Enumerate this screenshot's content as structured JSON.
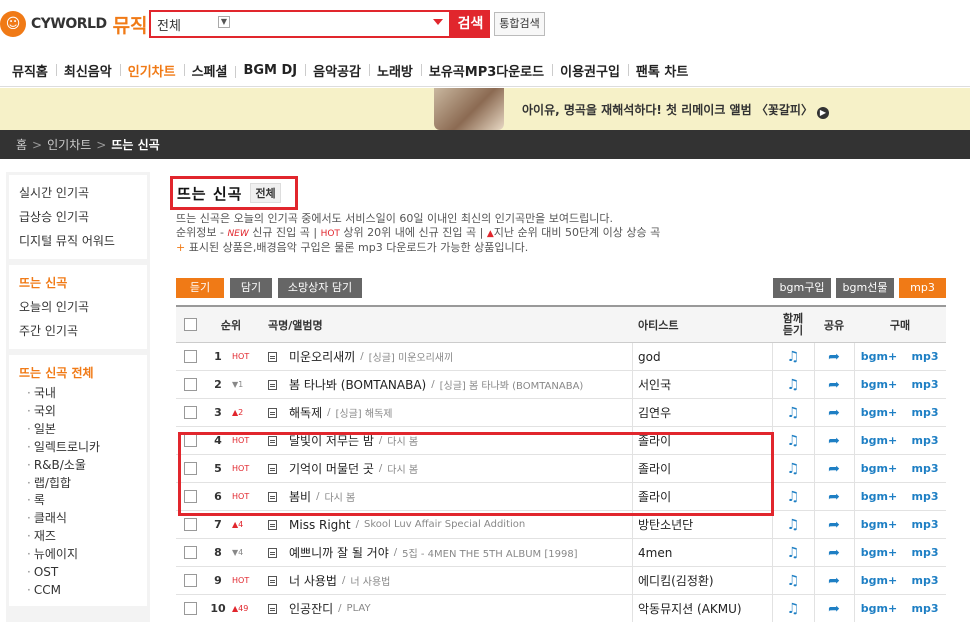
{
  "header": {
    "logo_text": "CYWORLD",
    "logo_music": "뮤직",
    "search": {
      "selected": "전체",
      "value": ""
    },
    "search_button": "검색",
    "total_search_button": "통합검색"
  },
  "nav": [
    "뮤직홈",
    "최신음악",
    "인기차트",
    "스페셜",
    "BGM DJ",
    "음악공감",
    "노래방",
    "보유곡MP3다운로드",
    "이용권구입",
    "팬톡 차트"
  ],
  "banner": {
    "text": "아이유, 명곡을 재해석하다! 첫 리메이크 앨범 〈꽃갈피〉"
  },
  "breadcrumb": {
    "home": "홈",
    "parent": "인기차트",
    "current": "뜨는 신곡"
  },
  "sidebar": {
    "group1": [
      "실시간 인기곡",
      "급상승 인기곡",
      "디지털 뮤직 어워드"
    ],
    "group2": [
      "뜨는 신곡",
      "오늘의 인기곡",
      "주간 인기곡"
    ],
    "group3_title": "뜨는 신곡 전체",
    "group3_items": [
      "국내",
      "국외",
      "일본",
      "일렉트로니카",
      "R&B/소울",
      "랩/힙합",
      "록",
      "클래식",
      "재즈",
      "뉴에이지",
      "OST",
      "CCM"
    ]
  },
  "main": {
    "title": "뜨는 신곡",
    "title_filter": "전체",
    "desc_line1": "뜨는 신곡은 오늘의 인기곡 중에서도 서비스일이 60일 이내인 최신의 인기곡만을 보여드립니다.",
    "desc_line2_a": "순위정보 - ",
    "desc_new": "NEW",
    "desc_line2_b": " 신규 진입 곡 | ",
    "desc_hot": "HOT",
    "desc_line2_c": " 상위 20위 내에 신규 진입 곡 | ",
    "desc_up": "▲",
    "desc_line2_d": "지난 순위 대비 50단계 이상 상승 곡",
    "desc_line3_plus": "+",
    "desc_line3": " 표시된 상품은,배경음악 구입은 물론 mp3 다운로드가 가능한 상품입니다.",
    "buttons": {
      "listen": "듣기",
      "add": "담기",
      "wishlist": "소망상자 담기",
      "bgm_buy": "bgm구입",
      "bgm_gift": "bgm선물",
      "mp3": "mp3"
    },
    "columns": {
      "rank": "순위",
      "song": "곡명/앨범명",
      "artist": "아티스트",
      "listen_together_1": "함께",
      "listen_together_2": "듣기",
      "share": "공유",
      "buy": "구매"
    },
    "bgm_label": "bgm+",
    "mp3_label": "mp3",
    "rows": [
      {
        "rank": "1",
        "change": "HOT",
        "title": "미운오리새끼",
        "album": "[싱글] 미운오리새끼",
        "artist": "god"
      },
      {
        "rank": "2",
        "change": "▼1",
        "title": "봄 타나봐 (BOMTANABA)",
        "album": "[싱글] 봄 타나봐 (BOMTANABA)",
        "artist": "서인국"
      },
      {
        "rank": "3",
        "change": "▲2",
        "title": "해독제",
        "album": "[싱글] 해독제",
        "artist": "김연우"
      },
      {
        "rank": "4",
        "change": "HOT",
        "title": "달빛이 저무는 밤",
        "album": "다시 봄",
        "artist": "졸라이"
      },
      {
        "rank": "5",
        "change": "HOT",
        "title": "기억이 머물던 곳",
        "album": "다시 봄",
        "artist": "졸라이"
      },
      {
        "rank": "6",
        "change": "HOT",
        "title": "봄비",
        "album": "다시 봄",
        "artist": "졸라이"
      },
      {
        "rank": "7",
        "change": "▲4",
        "title": "Miss Right",
        "album": "Skool Luv Affair Special Addition",
        "artist": "방탄소년단"
      },
      {
        "rank": "8",
        "change": "▼4",
        "title": "예쁘니까 잘 될 거야",
        "album": "5집 - 4MEN THE 5TH ALBUM [1998]",
        "artist": "4men"
      },
      {
        "rank": "9",
        "change": "HOT",
        "title": "너 사용법",
        "album": "너 사용법",
        "artist": "에디킴(김정환)"
      },
      {
        "rank": "10",
        "change": "▲49",
        "title": "인공잔디",
        "album": "PLAY",
        "artist": "악동뮤지션 (AKMU)"
      }
    ]
  }
}
